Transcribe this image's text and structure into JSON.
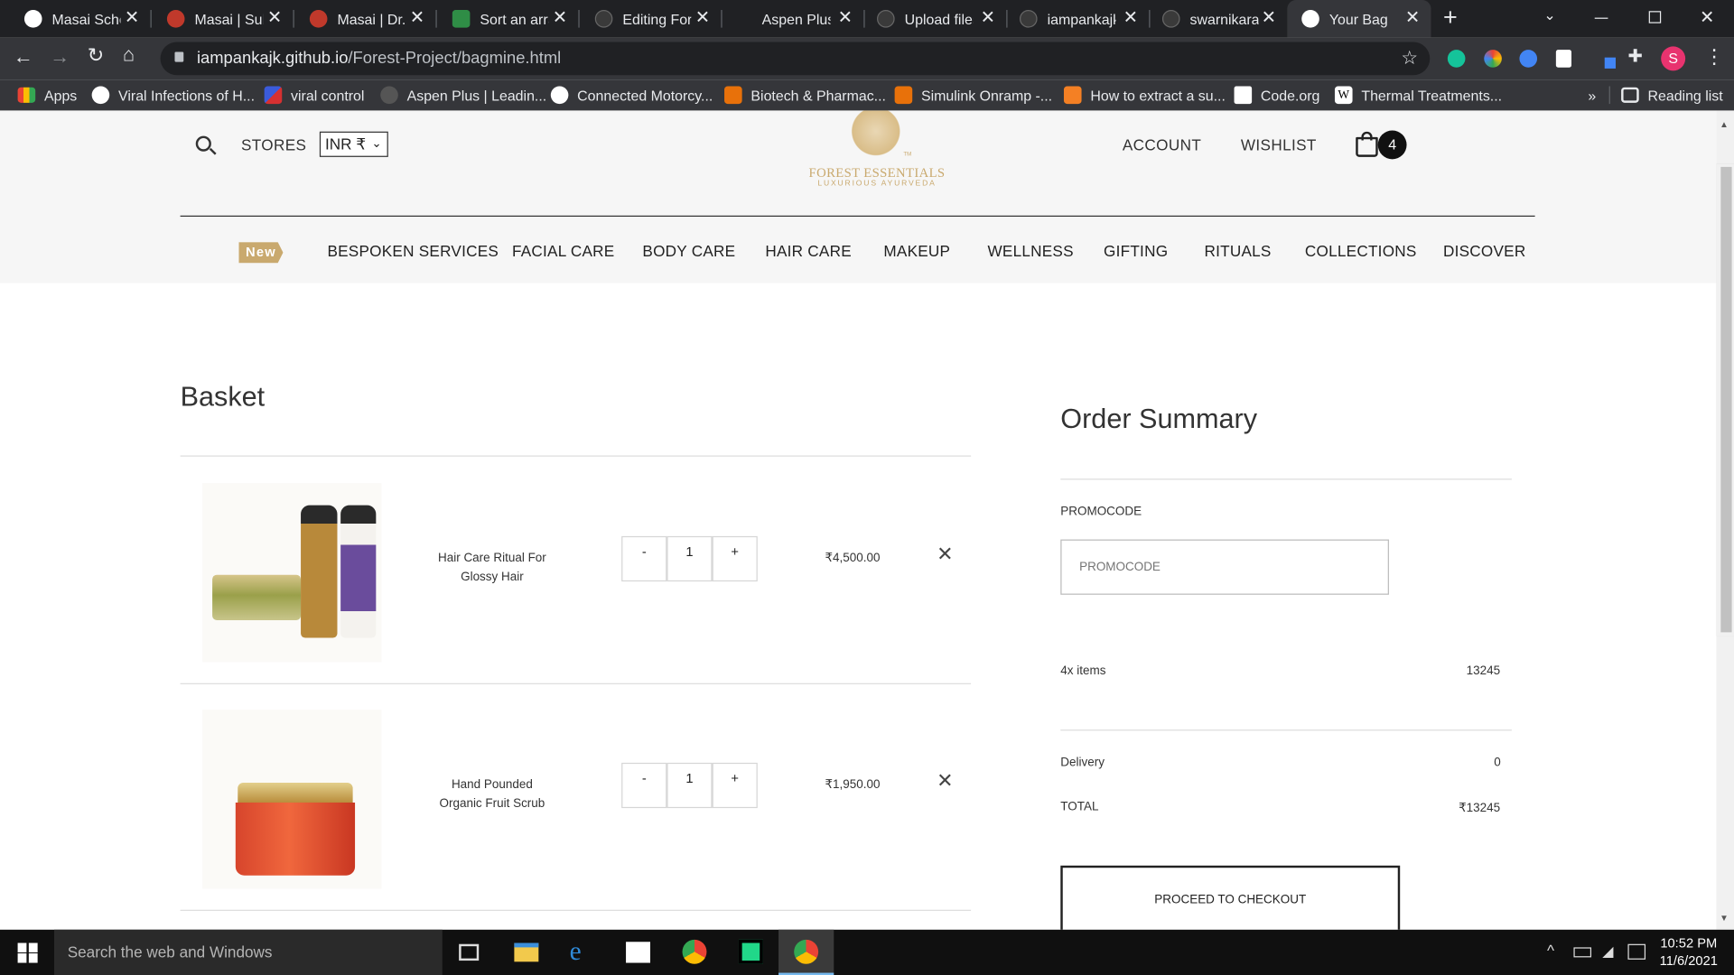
{
  "browser": {
    "tabs": [
      {
        "title": "Masai Scho",
        "icon_color": "#ffffff"
      },
      {
        "title": "Masai | Sub",
        "icon_color": "#c0392b"
      },
      {
        "title": "Masai | Dr.",
        "icon_color": "#c0392b"
      },
      {
        "title": "Sort an arra",
        "icon_color": "#2f8d46"
      },
      {
        "title": "Editing Fore",
        "icon_color": "#3a3a3a"
      },
      {
        "title": "Aspen Plus",
        "icon_color": "#202124"
      },
      {
        "title": "Upload files",
        "icon_color": "#3a3a3a"
      },
      {
        "title": "iampankajk",
        "icon_color": "#3a3a3a"
      },
      {
        "title": "swarnikaraj",
        "icon_color": "#3a3a3a"
      },
      {
        "title": "Your Bag",
        "icon_color": "#ffffff"
      }
    ],
    "new_tab": "+",
    "url_host": "iampankajk.github.io",
    "url_path": "/Forest-Project/bagmine.html",
    "profile_initial": "S",
    "bookmarks": [
      {
        "label": "Apps",
        "icon_color": "#e94235"
      },
      {
        "label": "Viral Infections of H...",
        "icon_color": "#ffffff"
      },
      {
        "label": "viral control",
        "icon_color": "#3b5bdb"
      },
      {
        "label": "Aspen Plus | Leadin...",
        "icon_color": "#555555"
      },
      {
        "label": "Connected Motorcy...",
        "icon_color": "#ffffff"
      },
      {
        "label": "Biotech & Pharmac...",
        "icon_color": "#e8710a"
      },
      {
        "label": "Simulink Onramp -...",
        "icon_color": "#e8710a"
      },
      {
        "label": "How to extract a su...",
        "icon_color": "#f48024"
      },
      {
        "label": "Code.org",
        "icon_color": "#ffffff"
      },
      {
        "label": "Thermal Treatments...",
        "icon_color": "#111111"
      }
    ],
    "bookmarks_more": "»",
    "reading_list": "Reading list"
  },
  "site": {
    "stores": "STORES",
    "currency": "INR ₹",
    "logo_title": "FOREST ESSENTIALS",
    "logo_tm": "TM",
    "logo_subtitle": "LUXURIOUS AYURVEDA",
    "account": "ACCOUNT",
    "wishlist": "WISHLIST",
    "bag_count": "4",
    "new_badge": "New",
    "nav": [
      "BESPOKEN SERVICES",
      "FACIAL CARE",
      "BODY CARE",
      "HAIR CARE",
      "MAKEUP",
      "WELLNESS",
      "GIFTING",
      "RITUALS",
      "COLLECTIONS",
      "DISCOVER"
    ],
    "accent_color": "#c9a96e"
  },
  "basket": {
    "title": "Basket",
    "items": [
      {
        "name_line1": "Hair Care Ritual For",
        "name_line2": "Glossy Hair",
        "qty": "1",
        "minus": "-",
        "plus": "+",
        "price": "₹4,500.00"
      },
      {
        "name_line1": "Hand Pounded",
        "name_line2": "Organic Fruit Scrub",
        "qty": "1",
        "minus": "-",
        "plus": "+",
        "price": "₹1,950.00"
      }
    ]
  },
  "summary": {
    "title": "Order Summary",
    "promo_label": "PROMOCODE",
    "promo_placeholder": "PROMOCODE",
    "items_label": "4x items",
    "items_value": "13245",
    "delivery_label": "Delivery",
    "delivery_value": "0",
    "total_label": "TOTAL",
    "total_value": "₹13245",
    "checkout": "PROCEED TO CHECKOUT"
  },
  "taskbar": {
    "search": "Search the web and Windows",
    "time": "10:52 PM",
    "date": "11/6/2021"
  }
}
